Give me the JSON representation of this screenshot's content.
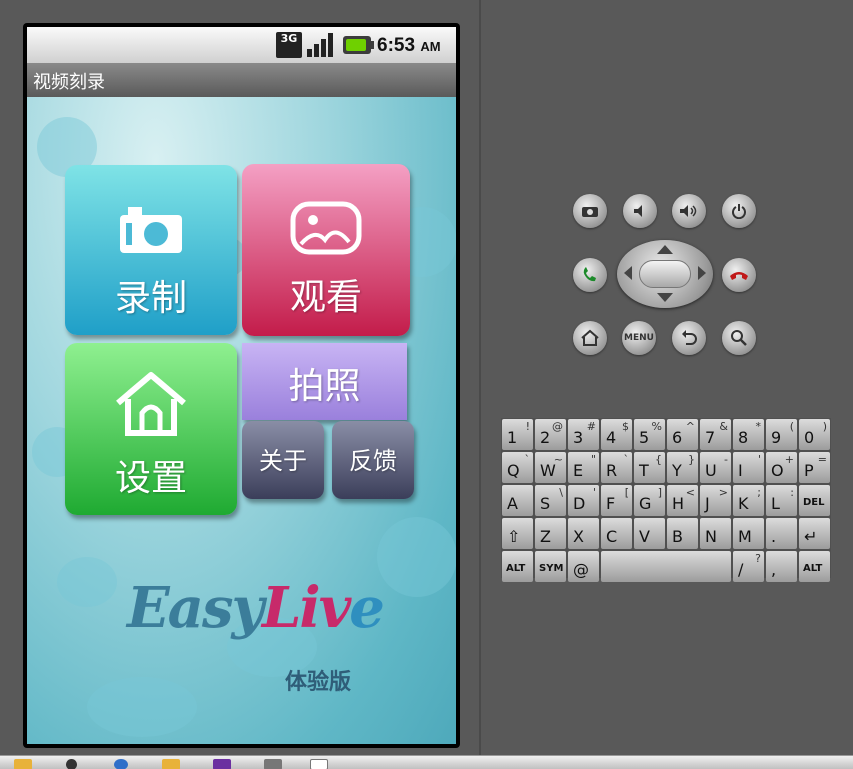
{
  "status_bar": {
    "network": "3G",
    "time": "6:53",
    "ampm": "AM"
  },
  "app": {
    "title": "视频刻录"
  },
  "tiles": {
    "record": "录制",
    "watch": "观看",
    "settings": "设置",
    "photo": "拍照",
    "about": "关于",
    "feedback": "反馈"
  },
  "logo": {
    "text_part1": "Easy",
    "text_part2": "Liv",
    "text_part3": "e",
    "edition": "体验版"
  },
  "emulator": {
    "menu_label": "MENU",
    "icons": [
      "camera-icon",
      "volume-down-icon",
      "volume-up-icon",
      "power-icon",
      "call-icon",
      "end-call-icon",
      "home-icon",
      "back-icon",
      "search-icon"
    ],
    "keyboard": {
      "row1": [
        [
          "1",
          "!"
        ],
        [
          "2",
          "@"
        ],
        [
          "3",
          "#"
        ],
        [
          "4",
          "$"
        ],
        [
          "5",
          "%"
        ],
        [
          "6",
          "^"
        ],
        [
          "7",
          "&"
        ],
        [
          "8",
          "*"
        ],
        [
          "9",
          "("
        ],
        [
          "0",
          ")"
        ]
      ],
      "row2": [
        [
          "Q",
          "`"
        ],
        [
          "W",
          "~"
        ],
        [
          "E",
          "\""
        ],
        [
          "R",
          "`"
        ],
        [
          "T",
          "{"
        ],
        [
          "Y",
          "}"
        ],
        [
          "U",
          "-"
        ],
        [
          "I",
          "'"
        ],
        [
          "O",
          "+"
        ],
        [
          "P",
          "="
        ]
      ],
      "row3": [
        [
          "A",
          ""
        ],
        [
          "S",
          "\\"
        ],
        [
          "D",
          "'"
        ],
        [
          "F",
          "["
        ],
        [
          "G",
          "]"
        ],
        [
          "H",
          "<"
        ],
        [
          "J",
          ">"
        ],
        [
          "K",
          ";"
        ],
        [
          "L",
          ":"
        ],
        [
          "DEL",
          ""
        ]
      ],
      "row4": [
        [
          "⇧",
          ""
        ],
        [
          "Z",
          ""
        ],
        [
          "X",
          ""
        ],
        [
          "C",
          ""
        ],
        [
          "V",
          ""
        ],
        [
          "B",
          ""
        ],
        [
          "N",
          ""
        ],
        [
          "M",
          ""
        ],
        [
          ".",
          ""
        ],
        [
          "↵",
          ""
        ]
      ],
      "row5": [
        [
          "ALT",
          ""
        ],
        [
          "SYM",
          ""
        ],
        [
          "@",
          ""
        ],
        [
          "",
          ""
        ],
        [
          "/",
          "?"
        ],
        [
          ",",
          ""
        ],
        [
          "ALT",
          ""
        ]
      ]
    }
  },
  "colors": {
    "record": "#1f9fc8",
    "watch": "#c31c4a",
    "settings": "#1faa32",
    "photo": "#9a80dc",
    "nav": "#3b3e5a"
  }
}
